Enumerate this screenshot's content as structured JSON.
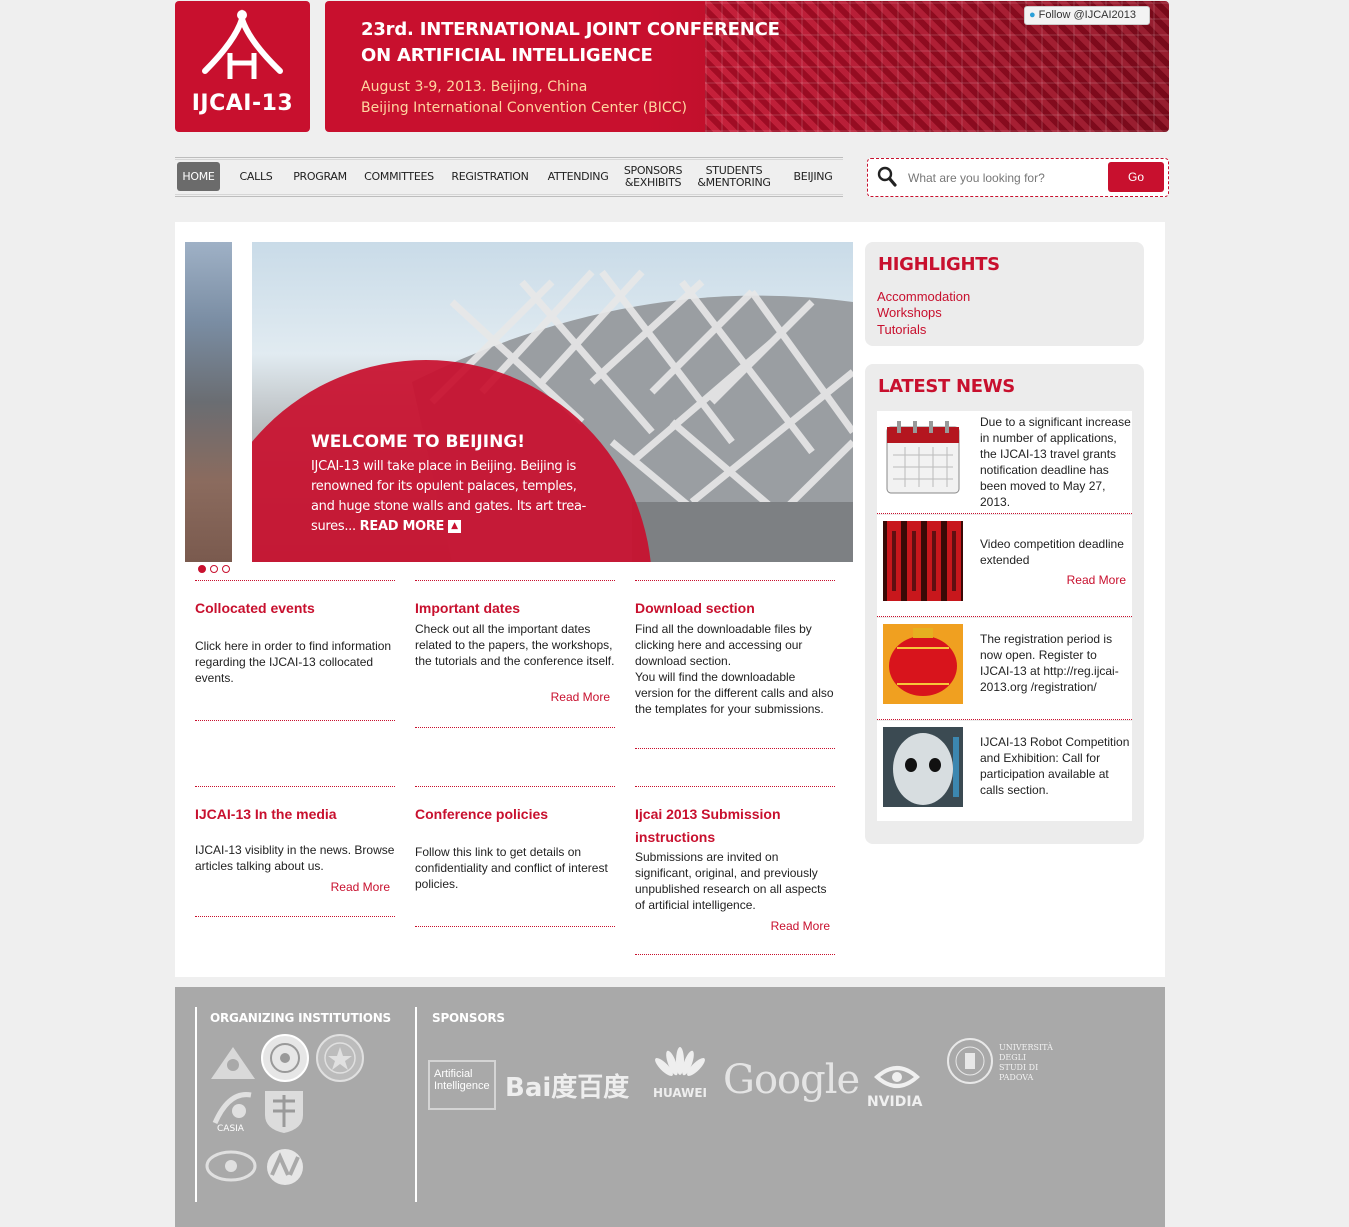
{
  "header": {
    "logo_text": "IJCAI-13",
    "banner_line1": "23rd. INTERNATIONAL JOINT CONFERENCE",
    "banner_line2": "ON ARTIFICIAL INTELLIGENCE",
    "banner_line3": "August 3-9, 2013. Beijing, China",
    "banner_line4": "Beijing International Convention Center (BICC)",
    "follow_label": "Follow @IJCAI2013"
  },
  "nav": {
    "items": [
      {
        "label": "HOME",
        "active": true
      },
      {
        "label": "CALLS"
      },
      {
        "label": "PROGRAM"
      },
      {
        "label": "COMMITTEES"
      },
      {
        "label": "REGISTRATION"
      },
      {
        "label": "ATTENDING"
      },
      {
        "label": "SPONSORS\n&EXHIBITS"
      },
      {
        "label": "STUDENTS\n&MENTORING"
      },
      {
        "label": "BEIJING"
      }
    ]
  },
  "search": {
    "placeholder": "What are you looking for?",
    "button": "Go"
  },
  "slider": {
    "title": "WELCOME TO BEIJING!",
    "body": "IJCAI-13 will take place in Beijing. Beijing is renowned for its opulent palaces, temples, and huge stone walls and gates. Its art trea-sures... ",
    "more": "READ MORE",
    "active_dot": 1,
    "dot_count": 3
  },
  "cards": [
    {
      "title": "Collocated events",
      "body": "Click here in order to find information regarding the IJCAI-13 collocated events.",
      "more": ""
    },
    {
      "title": "Important dates",
      "body": "Check out all the important dates related to the papers, the workshops, the tutorials and the conference itself.",
      "more": "Read More"
    },
    {
      "title": "Download section",
      "body": "Find all the downloadable files by clicking here and accessing our download section.\nYou will find the downloadable version for the different calls and also the templates for your submissions.",
      "more": ""
    },
    {
      "title": "IJCAI-13 In the media",
      "body": "IJCAI-13 visiblity in the news. Browse articles talking about us.",
      "more": "Read More"
    },
    {
      "title": "Conference policies",
      "body": "Follow this link to get details on confidentiality and conflict of interest policies.",
      "more": ""
    },
    {
      "title": "Ijcai 2013 Submission instructions",
      "body": "Submissions are invited on significant, original, and previously unpublished research on all aspects of artificial intelligence.",
      "more": "Read More"
    }
  ],
  "highlights": {
    "title": "HIGHLIGHTS",
    "links": [
      "Accommodation",
      "Workshops",
      "Tutorials"
    ]
  },
  "news": {
    "title": "LATEST NEWS",
    "items": [
      {
        "text": "Due to a significant increase in number of applications, the IJCAI-13 travel grants notification deadline has been moved to May 27, 2013.",
        "more": ""
      },
      {
        "text": "Video competition deadline extended",
        "more": "Read More"
      },
      {
        "text": "The registration period is now open. Register to IJCAI-13 at http://reg.ijcai-2013.org /registration/",
        "more": ""
      },
      {
        "text": "IJCAI-13 Robot Competition and Exhibition: Call for participation available at calls section.",
        "more": ""
      }
    ]
  },
  "footer": {
    "organizing_title": "ORGANIZING INSTITUTIONS",
    "sponsors_title": "SPONSORS",
    "sponsors": [
      "Artificial Intelligence",
      "Bai度百度",
      "HUAWEI",
      "Google",
      "NVIDIA",
      "UNIVERSITÀ DEGLI STUDI DI PADOVA"
    ],
    "org_logos": [
      "CASIA"
    ]
  },
  "colors": {
    "brand_red": "#c8102e",
    "footer_grey": "#a9a9a9",
    "panel_grey": "#ececec"
  }
}
